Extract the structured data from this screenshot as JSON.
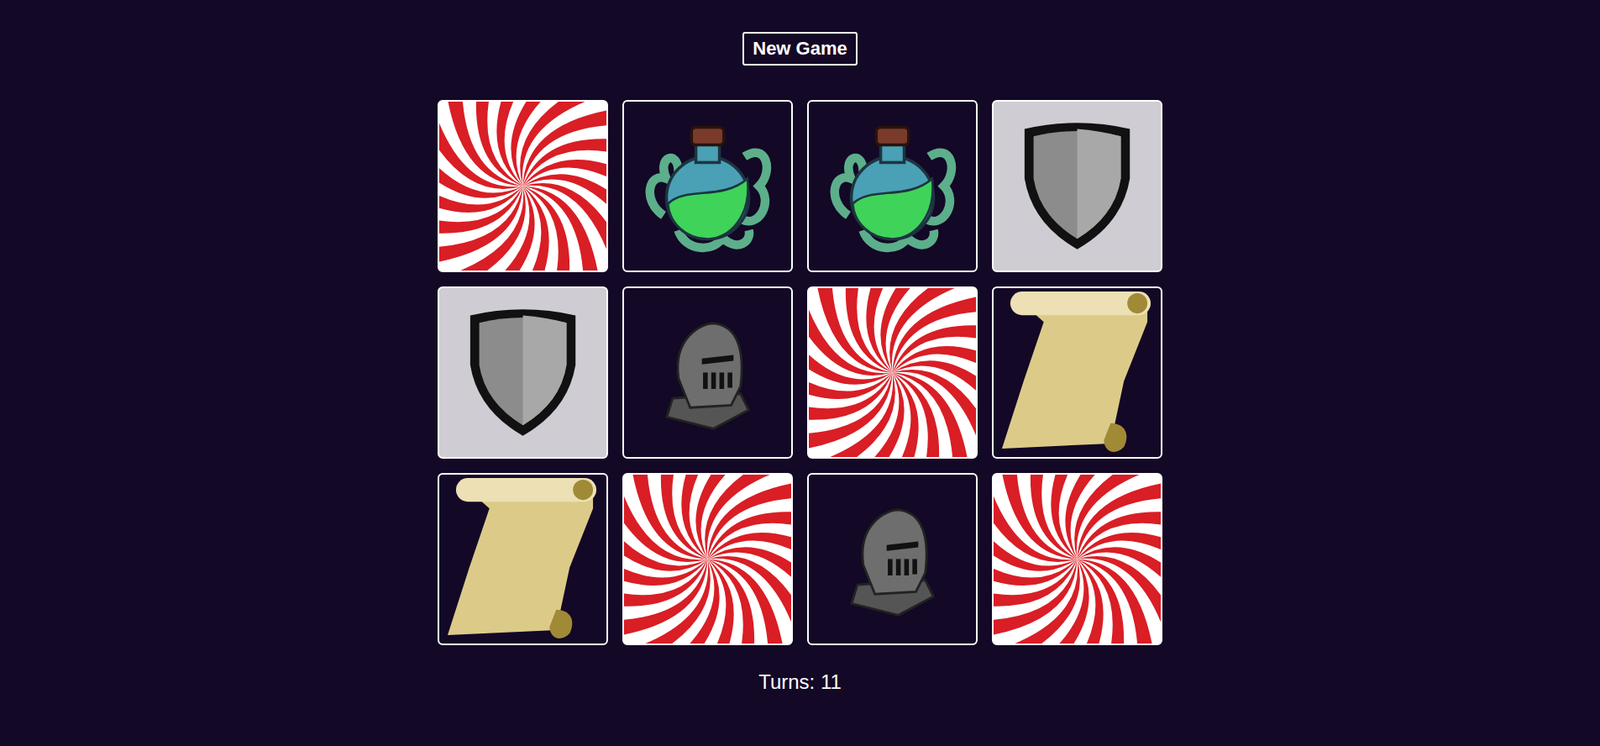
{
  "header": {
    "button": "New Game"
  },
  "cards": [
    {
      "kind": "back"
    },
    {
      "kind": "potion"
    },
    {
      "kind": "potion"
    },
    {
      "kind": "shield"
    },
    {
      "kind": "shield"
    },
    {
      "kind": "helmet"
    },
    {
      "kind": "back"
    },
    {
      "kind": "scroll"
    },
    {
      "kind": "scroll"
    },
    {
      "kind": "back"
    },
    {
      "kind": "helmet"
    },
    {
      "kind": "back"
    }
  ],
  "turns": {
    "label": "Turns: 11"
  }
}
